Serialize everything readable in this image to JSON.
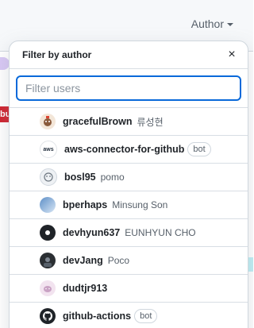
{
  "background": {
    "author_button_label": "Author",
    "left_badge_fragment": "bu"
  },
  "panel": {
    "title": "Filter by author",
    "close_label": "×",
    "filter_placeholder": "Filter users",
    "filter_value": ""
  },
  "users": [
    {
      "login": "gracefulBrown",
      "name": "류성현",
      "bot": "",
      "avatar": "graceful-avatar"
    },
    {
      "login": "aws-connector-for-github",
      "name": "",
      "bot": "bot",
      "avatar": "aws-logo-avatar"
    },
    {
      "login": "bosl95",
      "name": "pomo",
      "bot": "",
      "avatar": "bosl-avatar"
    },
    {
      "login": "bperhaps",
      "name": "Minsung Son",
      "bot": "",
      "avatar": "bperhaps-avatar"
    },
    {
      "login": "devhyun637",
      "name": "EUNHYUN CHO",
      "bot": "",
      "avatar": "devhyun-avatar"
    },
    {
      "login": "devJang",
      "name": "Poco",
      "bot": "",
      "avatar": "devjang-avatar"
    },
    {
      "login": "dudtjr913",
      "name": "",
      "bot": "",
      "avatar": "dudtjr-avatar"
    },
    {
      "login": "github-actions",
      "name": "",
      "bot": "bot",
      "avatar": "github-logo-avatar"
    }
  ],
  "colors": {
    "accent": "#0969da",
    "border": "#d0d7de",
    "text": "#1f2328",
    "muted": "#57606a"
  },
  "aws_avatar_text": "aws"
}
